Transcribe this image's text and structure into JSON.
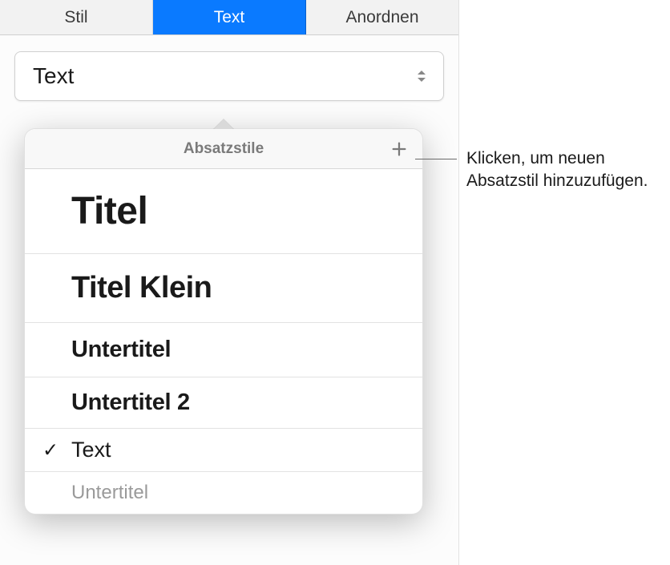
{
  "tabs": {
    "style": "Stil",
    "text": "Text",
    "arrange": "Anordnen"
  },
  "selector": {
    "current": "Text"
  },
  "popover": {
    "title": "Absatzstile",
    "styles": [
      {
        "label": "Titel",
        "selected": false
      },
      {
        "label": "Titel Klein",
        "selected": false
      },
      {
        "label": "Untertitel",
        "selected": false
      },
      {
        "label": "Untertitel 2",
        "selected": false
      },
      {
        "label": "Text",
        "selected": true
      },
      {
        "label": "Untertitel",
        "selected": false
      }
    ]
  },
  "callout": {
    "text": "Klicken, um neuen Absatzstil hinzuzufügen."
  }
}
